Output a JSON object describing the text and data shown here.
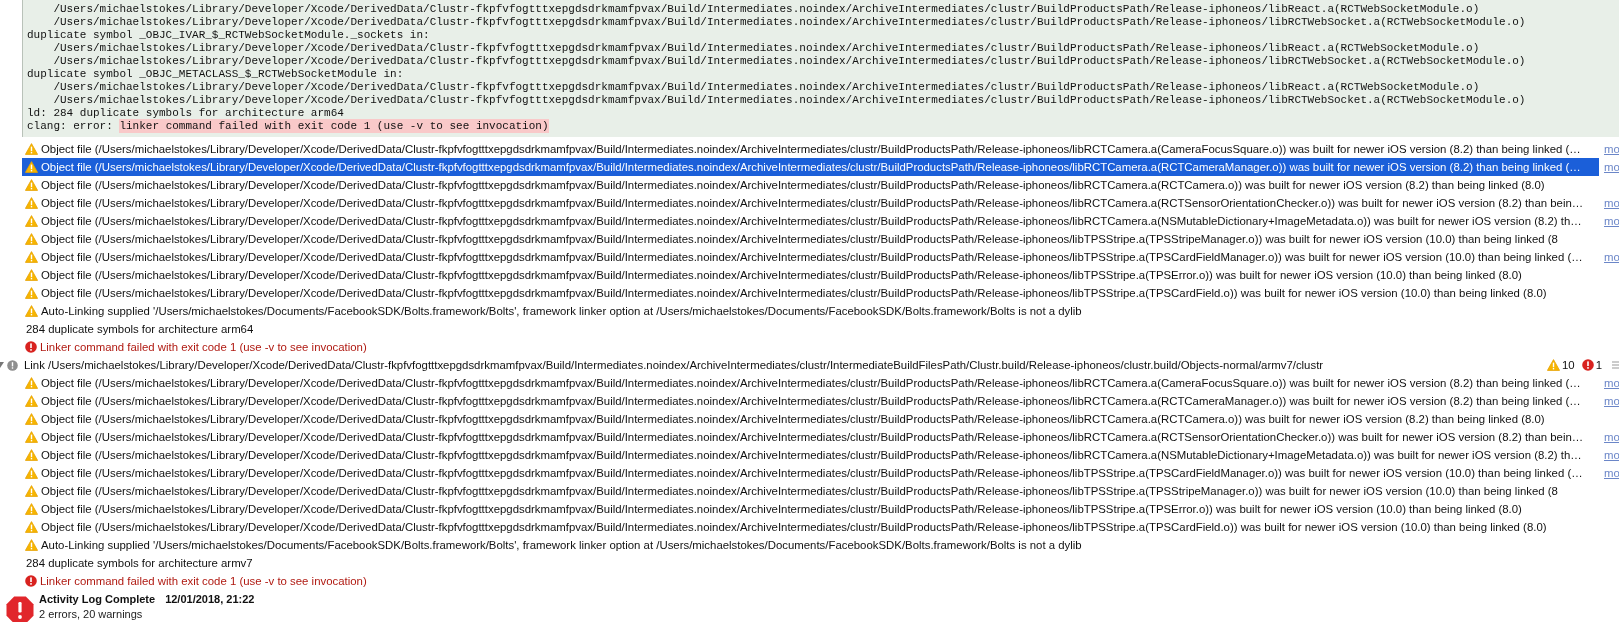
{
  "build_log": {
    "lines": [
      "    /Users/michaelstokes/Library/Developer/Xcode/DerivedData/Clustr-fkpfvfogtttxepgdsdrkmamfpvax/Build/Intermediates.noindex/ArchiveIntermediates/clustr/BuildProductsPath/Release-iphoneos/libReact.a(RCTWebSocketModule.o)",
      "    /Users/michaelstokes/Library/Developer/Xcode/DerivedData/Clustr-fkpfvfogtttxepgdsdrkmamfpvax/Build/Intermediates.noindex/ArchiveIntermediates/clustr/BuildProductsPath/Release-iphoneos/libRCTWebSocket.a(RCTWebSocketModule.o)",
      "duplicate symbol _OBJC_IVAR_$_RCTWebSocketModule._sockets in:",
      "    /Users/michaelstokes/Library/Developer/Xcode/DerivedData/Clustr-fkpfvfogtttxepgdsdrkmamfpvax/Build/Intermediates.noindex/ArchiveIntermediates/clustr/BuildProductsPath/Release-iphoneos/libReact.a(RCTWebSocketModule.o)",
      "    /Users/michaelstokes/Library/Developer/Xcode/DerivedData/Clustr-fkpfvfogtttxepgdsdrkmamfpvax/Build/Intermediates.noindex/ArchiveIntermediates/clustr/BuildProductsPath/Release-iphoneos/libRCTWebSocket.a(RCTWebSocketModule.o)",
      "duplicate symbol _OBJC_METACLASS_$_RCTWebSocketModule in:",
      "    /Users/michaelstokes/Library/Developer/Xcode/DerivedData/Clustr-fkpfvfogtttxepgdsdrkmamfpvax/Build/Intermediates.noindex/ArchiveIntermediates/clustr/BuildProductsPath/Release-iphoneos/libReact.a(RCTWebSocketModule.o)",
      "    /Users/michaelstokes/Library/Developer/Xcode/DerivedData/Clustr-fkpfvfogtttxepgdsdrkmamfpvax/Build/Intermediates.noindex/ArchiveIntermediates/clustr/BuildProductsPath/Release-iphoneos/libRCTWebSocket.a(RCTWebSocketModule.o)",
      "ld: 284 duplicate symbols for architecture arm64"
    ],
    "error_line": {
      "prefix": "clang: error: ",
      "message": "linker command failed with exit code 1 (use -v to see invocation)"
    }
  },
  "issues": [
    {
      "kind": "warning",
      "selected": false,
      "text": "Object file (/Users/michaelstokes/Library/Developer/Xcode/DerivedData/Clustr-fkpfvfogtttxepgdsdrkmamfpvax/Build/Intermediates.noindex/ArchiveIntermediates/clustr/BuildProductsPath/Release-iphoneos/libRCTCamera.a(CameraFocusSquare.o)) was built for newer iOS version (8.2) than being linked (…",
      "more_link": "mo"
    },
    {
      "kind": "warning",
      "selected": true,
      "text": "Object file (/Users/michaelstokes/Library/Developer/Xcode/DerivedData/Clustr-fkpfvfogtttxepgdsdrkmamfpvax/Build/Intermediates.noindex/ArchiveIntermediates/clustr/BuildProductsPath/Release-iphoneos/libRCTCamera.a(RCTCameraManager.o)) was built for newer iOS version (8.2) than being linked (…",
      "more_link": "mo"
    },
    {
      "kind": "warning",
      "selected": false,
      "text": "Object file (/Users/michaelstokes/Library/Developer/Xcode/DerivedData/Clustr-fkpfvfogtttxepgdsdrkmamfpvax/Build/Intermediates.noindex/ArchiveIntermediates/clustr/BuildProductsPath/Release-iphoneos/libRCTCamera.a(RCTCamera.o)) was built for newer iOS version (8.2) than being linked (8.0)"
    },
    {
      "kind": "warning",
      "selected": false,
      "text": "Object file (/Users/michaelstokes/Library/Developer/Xcode/DerivedData/Clustr-fkpfvfogtttxepgdsdrkmamfpvax/Build/Intermediates.noindex/ArchiveIntermediates/clustr/BuildProductsPath/Release-iphoneos/libRCTCamera.a(RCTSensorOrientationChecker.o)) was built for newer iOS version (8.2) than bein…",
      "more_link": "mo"
    },
    {
      "kind": "warning",
      "selected": false,
      "text": "Object file (/Users/michaelstokes/Library/Developer/Xcode/DerivedData/Clustr-fkpfvfogtttxepgdsdrkmamfpvax/Build/Intermediates.noindex/ArchiveIntermediates/clustr/BuildProductsPath/Release-iphoneos/libRCTCamera.a(NSMutableDictionary+ImageMetadata.o)) was built for newer iOS version (8.2) th…",
      "more_link": "mo"
    },
    {
      "kind": "warning",
      "selected": false,
      "text": "Object file (/Users/michaelstokes/Library/Developer/Xcode/DerivedData/Clustr-fkpfvfogtttxepgdsdrkmamfpvax/Build/Intermediates.noindex/ArchiveIntermediates/clustr/BuildProductsPath/Release-iphoneos/libTPSStripe.a(TPSStripeManager.o)) was built for newer iOS version (10.0) than being linked (8"
    },
    {
      "kind": "warning",
      "selected": false,
      "text": "Object file (/Users/michaelstokes/Library/Developer/Xcode/DerivedData/Clustr-fkpfvfogtttxepgdsdrkmamfpvax/Build/Intermediates.noindex/ArchiveIntermediates/clustr/BuildProductsPath/Release-iphoneos/libTPSStripe.a(TPSCardFieldManager.o)) was built for newer iOS version (10.0) than being linked (…",
      "more_link": "mo"
    },
    {
      "kind": "warning",
      "selected": false,
      "text": "Object file (/Users/michaelstokes/Library/Developer/Xcode/DerivedData/Clustr-fkpfvfogtttxepgdsdrkmamfpvax/Build/Intermediates.noindex/ArchiveIntermediates/clustr/BuildProductsPath/Release-iphoneos/libTPSStripe.a(TPSError.o)) was built for newer iOS version (10.0) than being linked (8.0)"
    },
    {
      "kind": "warning",
      "selected": false,
      "text": "Object file (/Users/michaelstokes/Library/Developer/Xcode/DerivedData/Clustr-fkpfvfogtttxepgdsdrkmamfpvax/Build/Intermediates.noindex/ArchiveIntermediates/clustr/BuildProductsPath/Release-iphoneos/libTPSStripe.a(TPSCardField.o)) was built for newer iOS version (10.0) than being linked (8.0)"
    },
    {
      "kind": "warning",
      "selected": false,
      "text": "Auto-Linking supplied '/Users/michaelstokes/Documents/FacebookSDK/Bolts.framework/Bolts', framework linker option at /Users/michaelstokes/Documents/FacebookSDK/Bolts.framework/Bolts is not a dylib"
    },
    {
      "kind": "plain",
      "selected": false,
      "text": "284 duplicate symbols for architecture arm64"
    },
    {
      "kind": "error",
      "selected": false,
      "text": "Linker command failed with exit code 1 (use -v to see invocation)"
    }
  ],
  "group": {
    "title": "Link /Users/michaelstokes/Library/Developer/Xcode/DerivedData/Clustr-fkpfvfogtttxepgdsdrkmamfpvax/Build/Intermediates.noindex/ArchiveIntermediates/clustr/IntermediateBuildFilesPath/Clustr.build/Release-iphoneos/clustr.build/Objects-normal/armv7/clustr",
    "expanded": true,
    "warning_count": "10",
    "error_count": "1",
    "issues": [
      {
        "kind": "warning",
        "selected": false,
        "text": "Object file (/Users/michaelstokes/Library/Developer/Xcode/DerivedData/Clustr-fkpfvfogtttxepgdsdrkmamfpvax/Build/Intermediates.noindex/ArchiveIntermediates/clustr/BuildProductsPath/Release-iphoneos/libRCTCamera.a(CameraFocusSquare.o)) was built for newer iOS version (8.2) than being linked (…",
        "more_link": "mo"
      },
      {
        "kind": "warning",
        "selected": false,
        "text": "Object file (/Users/michaelstokes/Library/Developer/Xcode/DerivedData/Clustr-fkpfvfogtttxepgdsdrkmamfpvax/Build/Intermediates.noindex/ArchiveIntermediates/clustr/BuildProductsPath/Release-iphoneos/libRCTCamera.a(RCTCameraManager.o)) was built for newer iOS version (8.2) than being linked (…",
        "more_link": "mo"
      },
      {
        "kind": "warning",
        "selected": false,
        "text": "Object file (/Users/michaelstokes/Library/Developer/Xcode/DerivedData/Clustr-fkpfvfogtttxepgdsdrkmamfpvax/Build/Intermediates.noindex/ArchiveIntermediates/clustr/BuildProductsPath/Release-iphoneos/libRCTCamera.a(RCTCamera.o)) was built for newer iOS version (8.2) than being linked (8.0)"
      },
      {
        "kind": "warning",
        "selected": false,
        "text": "Object file (/Users/michaelstokes/Library/Developer/Xcode/DerivedData/Clustr-fkpfvfogtttxepgdsdrkmamfpvax/Build/Intermediates.noindex/ArchiveIntermediates/clustr/BuildProductsPath/Release-iphoneos/libRCTCamera.a(RCTSensorOrientationChecker.o)) was built for newer iOS version (8.2) than bein…",
        "more_link": "mo"
      },
      {
        "kind": "warning",
        "selected": false,
        "text": "Object file (/Users/michaelstokes/Library/Developer/Xcode/DerivedData/Clustr-fkpfvfogtttxepgdsdrkmamfpvax/Build/Intermediates.noindex/ArchiveIntermediates/clustr/BuildProductsPath/Release-iphoneos/libRCTCamera.a(NSMutableDictionary+ImageMetadata.o)) was built for newer iOS version (8.2) th…",
        "more_link": "mo"
      },
      {
        "kind": "warning",
        "selected": false,
        "text": "Object file (/Users/michaelstokes/Library/Developer/Xcode/DerivedData/Clustr-fkpfvfogtttxepgdsdrkmamfpvax/Build/Intermediates.noindex/ArchiveIntermediates/clustr/BuildProductsPath/Release-iphoneos/libTPSStripe.a(TPSCardFieldManager.o)) was built for newer iOS version (10.0) than being linked (…",
        "more_link": "mo"
      },
      {
        "kind": "warning",
        "selected": false,
        "text": "Object file (/Users/michaelstokes/Library/Developer/Xcode/DerivedData/Clustr-fkpfvfogtttxepgdsdrkmamfpvax/Build/Intermediates.noindex/ArchiveIntermediates/clustr/BuildProductsPath/Release-iphoneos/libTPSStripe.a(TPSStripeManager.o)) was built for newer iOS version (10.0) than being linked (8"
      },
      {
        "kind": "warning",
        "selected": false,
        "text": "Object file (/Users/michaelstokes/Library/Developer/Xcode/DerivedData/Clustr-fkpfvfogtttxepgdsdrkmamfpvax/Build/Intermediates.noindex/ArchiveIntermediates/clustr/BuildProductsPath/Release-iphoneos/libTPSStripe.a(TPSError.o)) was built for newer iOS version (10.0) than being linked (8.0)"
      },
      {
        "kind": "warning",
        "selected": false,
        "text": "Object file (/Users/michaelstokes/Library/Developer/Xcode/DerivedData/Clustr-fkpfvfogtttxepgdsdrkmamfpvax/Build/Intermediates.noindex/ArchiveIntermediates/clustr/BuildProductsPath/Release-iphoneos/libTPSStripe.a(TPSCardField.o)) was built for newer iOS version (10.0) than being linked (8.0)"
      },
      {
        "kind": "warning",
        "selected": false,
        "text": "Auto-Linking supplied '/Users/michaelstokes/Documents/FacebookSDK/Bolts.framework/Bolts', framework linker option at /Users/michaelstokes/Documents/FacebookSDK/Bolts.framework/Bolts is not a dylib"
      },
      {
        "kind": "plain",
        "selected": false,
        "text": "284 duplicate symbols for architecture armv7"
      },
      {
        "kind": "error",
        "selected": false,
        "text": "Linker command failed with exit code 1 (use -v to see invocation)"
      }
    ]
  },
  "status": {
    "title": "Activity Log Complete",
    "time": "12/01/2018, 21:22",
    "summary": "2 errors, 20 warnings"
  }
}
